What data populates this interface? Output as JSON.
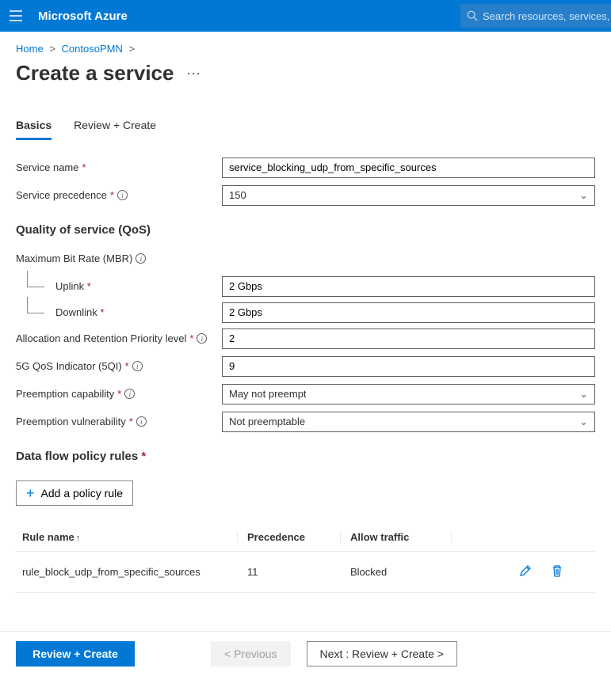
{
  "topbar": {
    "brand": "Microsoft Azure",
    "search_placeholder": "Search resources, services, and"
  },
  "breadcrumb": {
    "items": [
      "Home",
      "ContosoPMN"
    ]
  },
  "page": {
    "title": "Create a service"
  },
  "tabs": {
    "basics": "Basics",
    "review": "Review + Create"
  },
  "form": {
    "service_name_label": "Service name",
    "service_name_value": "service_blocking_udp_from_specific_sources",
    "service_precedence_label": "Service precedence",
    "service_precedence_value": "150",
    "qos_heading": "Quality of service (QoS)",
    "mbr_label": "Maximum Bit Rate (MBR)",
    "uplink_label": "Uplink",
    "uplink_value": "2 Gbps",
    "downlink_label": "Downlink",
    "downlink_value": "2 Gbps",
    "arp_label": "Allocation and Retention Priority level",
    "arp_value": "2",
    "fiveqi_label": "5G QoS Indicator (5QI)",
    "fiveqi_value": "9",
    "preempt_cap_label": "Preemption capability",
    "preempt_cap_value": "May not preempt",
    "preempt_vuln_label": "Preemption vulnerability",
    "preempt_vuln_value": "Not preemptable",
    "rules_heading": "Data flow policy rules",
    "add_rule_label": "Add a policy rule"
  },
  "table": {
    "headers": {
      "rule_name": "Rule name",
      "precedence": "Precedence",
      "allow_traffic": "Allow traffic"
    },
    "rows": [
      {
        "name": "rule_block_udp_from_specific_sources",
        "precedence": "11",
        "allow": "Blocked"
      }
    ]
  },
  "footer": {
    "review": "Review + Create",
    "previous": "< Previous",
    "next": "Next : Review + Create >"
  }
}
